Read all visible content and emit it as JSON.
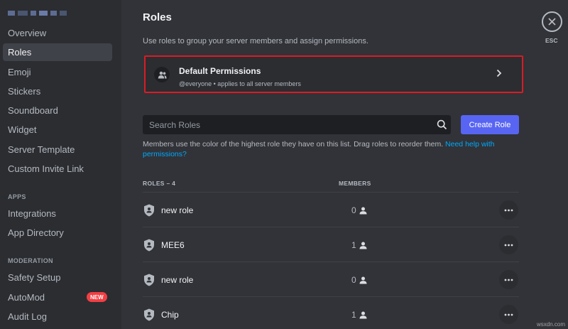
{
  "sidebar": {
    "items": [
      {
        "label": "Overview",
        "active": false
      },
      {
        "label": "Roles",
        "active": true
      },
      {
        "label": "Emoji",
        "active": false
      },
      {
        "label": "Stickers",
        "active": false
      },
      {
        "label": "Soundboard",
        "active": false
      },
      {
        "label": "Widget",
        "active": false
      },
      {
        "label": "Server Template",
        "active": false
      },
      {
        "label": "Custom Invite Link",
        "active": false
      }
    ],
    "apps_header": "APPS",
    "apps_items": [
      {
        "label": "Integrations"
      },
      {
        "label": "App Directory"
      }
    ],
    "moderation_header": "MODERATION",
    "moderation_items": [
      {
        "label": "Safety Setup"
      },
      {
        "label": "AutoMod",
        "badge": "NEW"
      },
      {
        "label": "Audit Log"
      }
    ]
  },
  "main": {
    "title": "Roles",
    "description": "Use roles to group your server members and assign permissions.",
    "default_permissions": {
      "title": "Default Permissions",
      "subtitle": "@everyone • applies to all server members",
      "highlight_color": "#d91c25"
    },
    "search": {
      "placeholder": "Search Roles"
    },
    "create_role_label": "Create Role",
    "info_text": "Members use the color of the highest role they have on this list. Drag roles to reorder them.",
    "info_link": "Need help with permissions?",
    "roles_header": "ROLES – 4",
    "members_header": "MEMBERS",
    "roles": [
      {
        "name": "new role",
        "members": "0"
      },
      {
        "name": "MEE6",
        "members": "1"
      },
      {
        "name": "new role",
        "members": "0"
      },
      {
        "name": "Chip",
        "members": "1"
      }
    ]
  },
  "close": {
    "label": "ESC"
  },
  "watermark": "wsxdn.com",
  "colors": {
    "background": "#313338",
    "sidebar": "#2b2d31",
    "accent": "#5865f2",
    "link": "#00a8fc",
    "badge": "#f23f43"
  },
  "icons": [
    "members-icon",
    "chevron-right-icon",
    "search-icon",
    "shield-icon",
    "person-icon",
    "more-icon",
    "close-icon"
  ]
}
